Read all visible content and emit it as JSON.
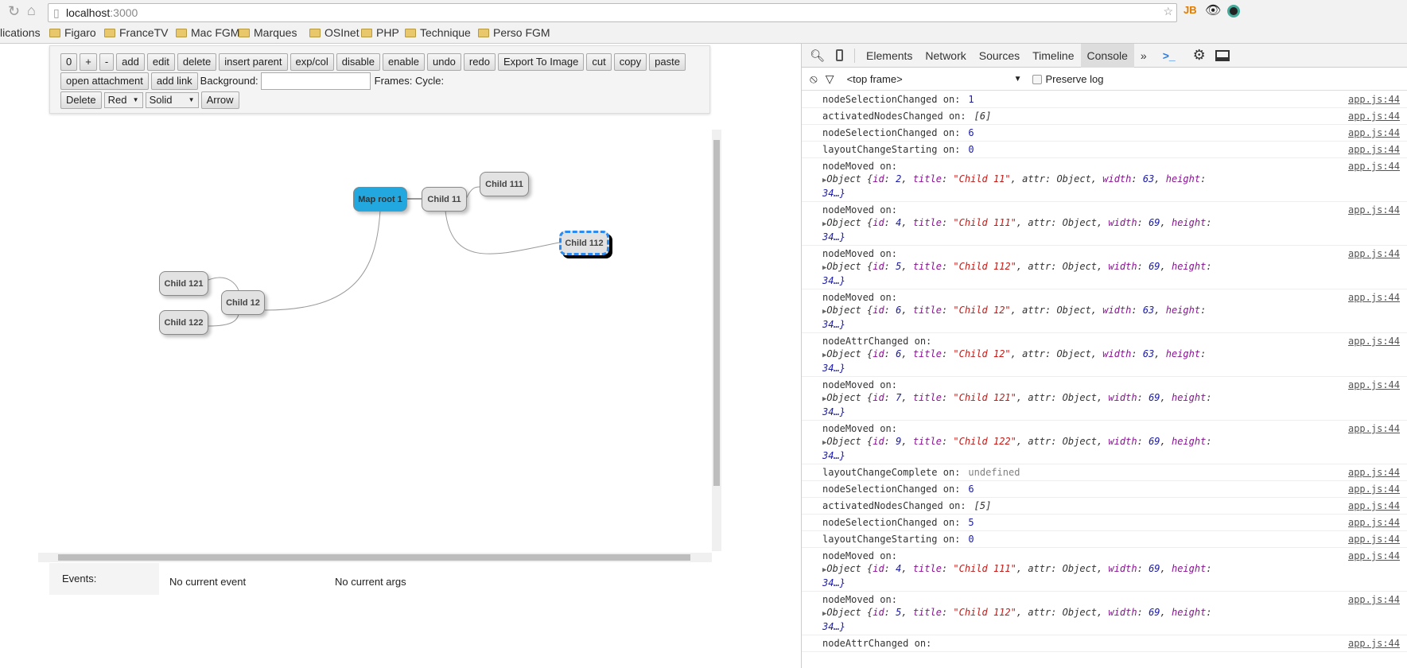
{
  "browser": {
    "url_host": "localhost",
    "url_port": ":3000",
    "bookmarks": [
      "lications",
      "Figaro",
      "FranceTV",
      "Mac FGM",
      "Marques",
      "OSInet",
      "PHP",
      "Technique",
      "Perso FGM"
    ]
  },
  "toolbar": {
    "buttons_row1": [
      "0",
      "+",
      "-",
      "add",
      "edit",
      "delete",
      "insert parent",
      "exp/col",
      "disable",
      "enable",
      "undo",
      "redo",
      "Export To Image",
      "cut",
      "copy",
      "paste"
    ],
    "open_attachment": "open attachment",
    "add_link": "add link",
    "background_label": "Background:",
    "background_value": "",
    "frames_label": "Frames: Cycle:",
    "delete_label": "Delete",
    "color_select": "Red",
    "style_select": "Solid",
    "arrow_label": "Arrow"
  },
  "map": {
    "nodes": [
      {
        "id": "root",
        "title": "Map root 1",
        "selected": false,
        "root": true
      },
      {
        "id": "c11",
        "title": "Child 11"
      },
      {
        "id": "c111",
        "title": "Child 111"
      },
      {
        "id": "c112",
        "title": "Child 112",
        "selected": true
      },
      {
        "id": "c121",
        "title": "Child 121"
      },
      {
        "id": "c12",
        "title": "Child 12"
      },
      {
        "id": "c122",
        "title": "Child 122"
      }
    ],
    "root_color": "#22a7de",
    "selection_color": "#2a8cf0"
  },
  "events": {
    "label": "Events:",
    "current_event": "No current event",
    "current_args": "No current args"
  },
  "devtools": {
    "tabs": [
      "Elements",
      "Network",
      "Sources",
      "Timeline",
      "Console"
    ],
    "active_tab": "Console",
    "more": "»",
    "frame": "<top frame>",
    "preserve_log": "Preserve log",
    "entries": [
      {
        "msg": "nodeSelectionChanged on:",
        "value": "1",
        "type": "num",
        "src": "app.js:44"
      },
      {
        "msg": "activatedNodesChanged on:",
        "value": "[6]",
        "type": "arr",
        "src": "app.js:44"
      },
      {
        "msg": "nodeSelectionChanged on:",
        "value": "6",
        "type": "num",
        "src": "app.js:44"
      },
      {
        "msg": "layoutChangeStarting on:",
        "value": "0",
        "type": "num",
        "src": "app.js:44"
      },
      {
        "msg": "nodeMoved on:",
        "obj": {
          "id": "2",
          "title": "\"Child 11\"",
          "width": "63",
          "height": "34…}"
        },
        "src": "app.js:44"
      },
      {
        "msg": "nodeMoved on:",
        "obj": {
          "id": "4",
          "title": "\"Child 111\"",
          "width": "69",
          "height": "34…}"
        },
        "src": "app.js:44"
      },
      {
        "msg": "nodeMoved on:",
        "obj": {
          "id": "5",
          "title": "\"Child 112\"",
          "width": "69",
          "height": "34…}"
        },
        "src": "app.js:44"
      },
      {
        "msg": "nodeMoved on:",
        "obj": {
          "id": "6",
          "title": "\"Child 12\"",
          "width": "63",
          "height": "34…}"
        },
        "src": "app.js:44"
      },
      {
        "msg": "nodeAttrChanged on:",
        "obj": {
          "id": "6",
          "title": "\"Child 12\"",
          "width": "63",
          "height": "34…}"
        },
        "src": "app.js:44"
      },
      {
        "msg": "nodeMoved on:",
        "obj": {
          "id": "7",
          "title": "\"Child 121\"",
          "width": "69",
          "height": "34…}"
        },
        "src": "app.js:44"
      },
      {
        "msg": "nodeMoved on:",
        "obj": {
          "id": "9",
          "title": "\"Child 122\"",
          "width": "69",
          "height": "34…}"
        },
        "src": "app.js:44"
      },
      {
        "msg": "layoutChangeComplete on:",
        "value": "undefined",
        "type": "undef",
        "src": "app.js:44"
      },
      {
        "msg": "nodeSelectionChanged on:",
        "value": "6",
        "type": "num",
        "src": "app.js:44"
      },
      {
        "msg": "activatedNodesChanged on:",
        "value": "[5]",
        "type": "arr",
        "src": "app.js:44"
      },
      {
        "msg": "nodeSelectionChanged on:",
        "value": "5",
        "type": "num",
        "src": "app.js:44"
      },
      {
        "msg": "layoutChangeStarting on:",
        "value": "0",
        "type": "num",
        "src": "app.js:44"
      },
      {
        "msg": "nodeMoved on:",
        "obj": {
          "id": "4",
          "title": "\"Child 111\"",
          "width": "69",
          "height": "34…}"
        },
        "src": "app.js:44"
      },
      {
        "msg": "nodeMoved on:",
        "obj": {
          "id": "5",
          "title": "\"Child 112\"",
          "width": "69",
          "height": "34…}"
        },
        "src": "app.js:44"
      },
      {
        "msg": "nodeAttrChanged on:",
        "value": "",
        "type": "num",
        "src": "app.js:44"
      }
    ]
  }
}
